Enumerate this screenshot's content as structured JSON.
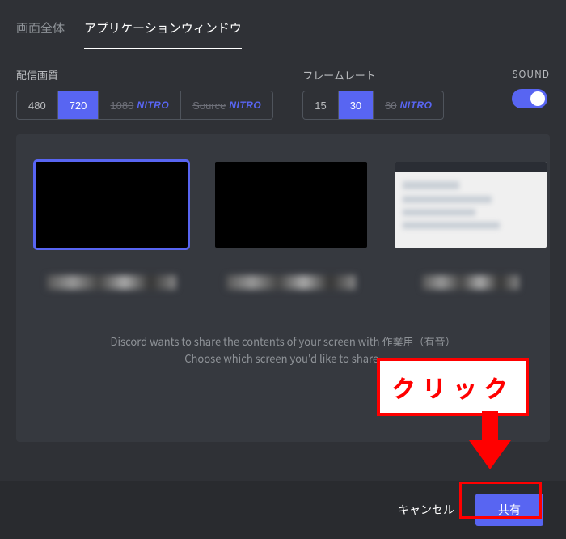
{
  "tabs": {
    "screen": "画面全体",
    "app": "アプリケーションウィンドウ"
  },
  "quality": {
    "label": "配信画質",
    "opt480": "480",
    "opt720": "720",
    "opt1080": "1080",
    "optSource": "Source",
    "nitro": "NITRO"
  },
  "framerate": {
    "label": "フレームレート",
    "opt15": "15",
    "opt30": "30",
    "opt60": "60",
    "nitro": "NITRO"
  },
  "sound": {
    "label": "SOUND"
  },
  "hint": {
    "line1": "Discord wants to share the contents of your screen with 作業用（有音）",
    "line2": "Choose which screen you'd like to share."
  },
  "footer": {
    "cancel": "キャンセル",
    "share": "共有"
  },
  "annotation": {
    "click": "クリック"
  }
}
